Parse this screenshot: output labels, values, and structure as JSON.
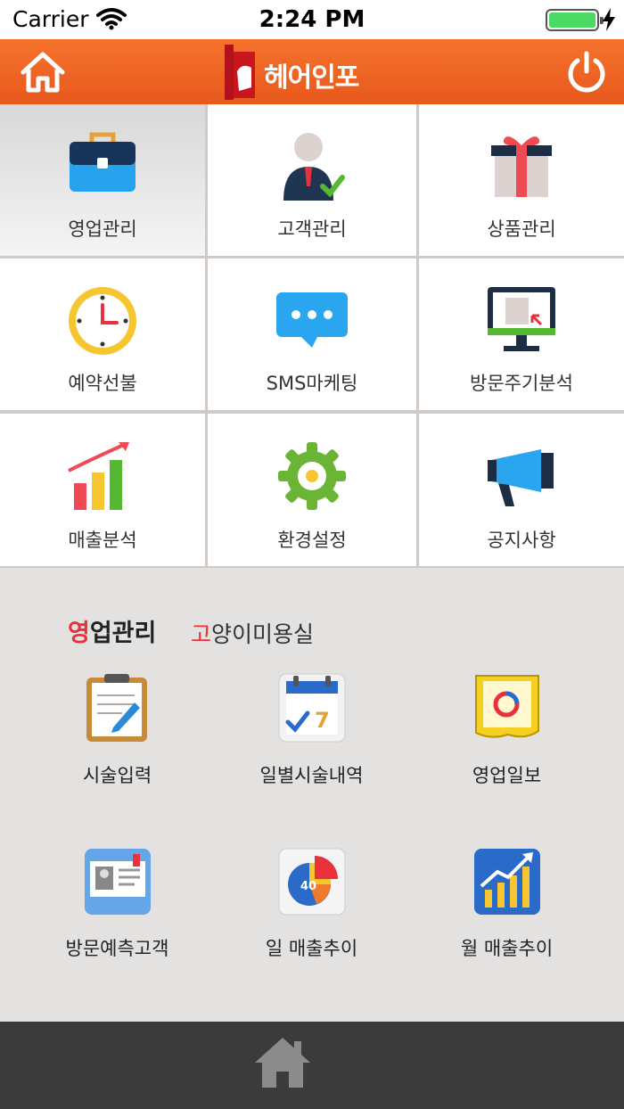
{
  "status": {
    "carrier": "Carrier",
    "time": "2:24 PM"
  },
  "header": {
    "logo_text": "헤어인포"
  },
  "grid": [
    {
      "label": "영업관리",
      "icon": "briefcase-icon"
    },
    {
      "label": "고객관리",
      "icon": "customer-icon"
    },
    {
      "label": "상품관리",
      "icon": "gift-icon"
    },
    {
      "label": "예약선불",
      "icon": "clock-icon"
    },
    {
      "label": "SMS마케팅",
      "icon": "message-icon"
    },
    {
      "label": "방문주기분석",
      "icon": "monitor-icon"
    },
    {
      "label": "매출분석",
      "icon": "bar-chart-icon"
    },
    {
      "label": "환경설정",
      "icon": "gear-icon"
    },
    {
      "label": "공지사항",
      "icon": "megaphone-icon"
    }
  ],
  "section": {
    "title_first": "영",
    "title_rest": "업관리",
    "shop_first": "고",
    "shop_rest": "양이미용실"
  },
  "submenu": [
    {
      "label": "시술입력",
      "icon": "clipboard-icon"
    },
    {
      "label": "일별시술내역",
      "icon": "calendar-icon"
    },
    {
      "label": "영업일보",
      "icon": "report-icon"
    },
    {
      "label": "방문예측고객",
      "icon": "id-card-icon"
    },
    {
      "label": "일 매출추이",
      "icon": "pie-chart-icon"
    },
    {
      "label": "월 매출추이",
      "icon": "trend-chart-icon"
    }
  ],
  "icons": {
    "pie_value": "40",
    "calendar_day": "7"
  },
  "colors": {
    "header": "#f0642a",
    "accent": "#e8313a",
    "bottom_bar": "#3b3b3b"
  }
}
